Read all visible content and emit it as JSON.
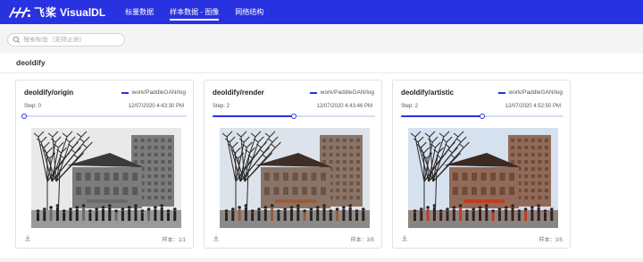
{
  "app": {
    "brand_cn": "飞桨",
    "brand_en": "VisualDL",
    "brand_color": "#2932e1",
    "nav": [
      {
        "label": "标量数据",
        "active": false
      },
      {
        "label": "样本数据 - 图像",
        "active": true
      },
      {
        "label": "网络结构",
        "active": false
      }
    ]
  },
  "search": {
    "placeholder": "搜索标签（支持正则）",
    "icon": "search-icon"
  },
  "group": {
    "title": "deoldify"
  },
  "cards": [
    {
      "title": "deoldify/origin",
      "run": "work/PaddleGAN/log",
      "step_label": "Step: 0",
      "time": "12/07/2020 4:43:30 PM",
      "samples": "样本：1/1",
      "progress": 0.0,
      "style": "bw"
    },
    {
      "title": "deoldify/render",
      "run": "work/PaddleGAN/log",
      "step_label": "Step: 2",
      "time": "12/07/2020 4:43:46 PM",
      "samples": "样本：3/5",
      "progress": 0.5,
      "style": "color"
    },
    {
      "title": "deoldify/artistic",
      "run": "work/PaddleGAN/log",
      "step_label": "Step: 2",
      "time": "12/07/2020 4:52:50 PM",
      "samples": "样本：3/5",
      "progress": 0.5,
      "style": "vivid"
    }
  ],
  "icons": {
    "download": "download-icon"
  }
}
